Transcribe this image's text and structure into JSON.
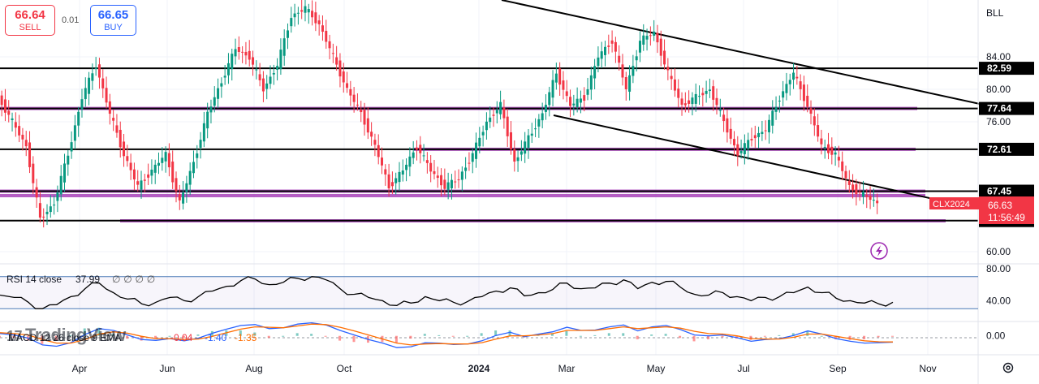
{
  "trade": {
    "sell_price": "66.64",
    "sell_label": "SELL",
    "spread": "0.01",
    "buy_price": "66.65",
    "buy_label": "BUY"
  },
  "symbol": "BLL",
  "watermark": "TradingView",
  "colors": {
    "up": "#089981",
    "down": "#f23645",
    "level": "#000000",
    "purple": "#9c27b0",
    "rsi": "#000000",
    "macd": "#2962ff",
    "signal": "#ff6d00"
  },
  "chart_data": [
    {
      "type": "candlestick",
      "title": "",
      "x_ticks": [
        "Apr",
        "Jun",
        "Aug",
        "Oct",
        "2024",
        "Mar",
        "May",
        "Jul",
        "Sep",
        "Nov"
      ],
      "y_ticks": [
        "84.00",
        "80.00",
        "76.00",
        "60.00"
      ],
      "ylim": [
        58.5,
        91
      ],
      "grid": true,
      "levels": [
        82.59,
        77.64,
        72.61,
        67.45,
        63.83
      ],
      "purple_zones": [
        77.64,
        72.61,
        67.45,
        66.9,
        63.8
      ],
      "current_price": "66.63",
      "symbol_label": "CLX2024",
      "countdown": "11:56:49",
      "series": [
        {
          "name": "",
          "values": [
            79,
            76,
            73,
            64,
            66,
            72,
            79,
            83,
            77,
            72,
            68,
            70,
            72,
            66,
            71,
            77,
            81,
            85,
            84,
            80,
            83,
            89,
            90,
            88,
            84,
            80,
            77,
            73,
            68,
            70,
            73,
            70,
            68,
            69,
            72,
            76,
            78,
            71,
            74,
            77,
            82,
            78,
            79,
            84,
            86,
            80,
            86,
            87,
            82,
            78,
            79,
            80,
            76,
            72,
            74,
            75,
            79,
            82,
            78,
            73,
            72,
            68,
            67,
            66
          ]
        }
      ]
    },
    {
      "type": "line",
      "title": "",
      "label": "RSI 14 close",
      "value": "37.99",
      "extra": "∅ ∅ ∅ ∅",
      "y_ticks": [
        "80.00",
        "40.00"
      ],
      "ylim": [
        15,
        85
      ],
      "bands": [
        70,
        30
      ],
      "series": [
        {
          "name": "",
          "values": [
            47,
            44,
            38,
            30,
            35,
            45,
            55,
            62,
            50,
            42,
            36,
            38,
            44,
            40,
            45,
            52,
            58,
            65,
            67,
            60,
            63,
            68,
            70,
            66,
            55,
            48,
            44,
            40,
            34,
            37,
            45,
            40,
            38,
            39,
            45,
            52,
            56,
            46,
            50,
            54,
            62,
            55,
            56,
            62,
            66,
            55,
            63,
            64,
            57,
            48,
            47,
            50,
            45,
            40,
            44,
            45,
            50,
            57,
            50,
            43,
            40,
            37,
            36,
            38
          ]
        }
      ]
    },
    {
      "type": "line",
      "title": "",
      "label": "MACD 12 26 close 9 EMA",
      "values_label": [
        "-0.04",
        "-1.40",
        "-1.35"
      ],
      "y_ticks": [
        "0.00"
      ],
      "ylim": [
        -4,
        3
      ],
      "series": [
        {
          "name": "",
          "values": [
            0.5,
            0.2,
            -0.5,
            -2.0,
            -2.3,
            -1.5,
            0.3,
            1.6,
            1.2,
            0.2,
            -0.8,
            -1.0,
            -0.6,
            -1.1,
            -0.5,
            0.6,
            1.5,
            2.3,
            2.5,
            1.6,
            1.8,
            2.6,
            2.9,
            2.4,
            1.2,
            0.2,
            -0.8,
            -1.6,
            -2.6,
            -2.4,
            -1.5,
            -1.6,
            -1.9,
            -1.8,
            -1.1,
            0.1,
            0.8,
            -0.2,
            0.4,
            0.9,
            1.9,
            1.2,
            1.3,
            2.0,
            2.4,
            1.1,
            2.0,
            2.3,
            1.4,
            0.2,
            0.0,
            0.2,
            -0.4,
            -1.2,
            -0.8,
            -0.6,
            0.1,
            1.1,
            0.4,
            -0.6,
            -1.2,
            -1.6,
            -1.5,
            -1.4
          ]
        },
        {
          "name": "",
          "values": [
            0.7,
            0.5,
            0.2,
            -0.8,
            -1.6,
            -1.6,
            -0.8,
            0.4,
            0.9,
            0.6,
            -0.1,
            -0.6,
            -0.6,
            -0.8,
            -0.7,
            -0.1,
            0.7,
            1.5,
            2.0,
            1.9,
            1.8,
            2.2,
            2.6,
            2.5,
            1.9,
            1.1,
            0.2,
            -0.7,
            -1.6,
            -2.0,
            -1.8,
            -1.7,
            -1.8,
            -1.8,
            -1.5,
            -0.7,
            0.0,
            0.0,
            0.2,
            0.5,
            1.2,
            1.2,
            1.2,
            1.6,
            2.0,
            1.6,
            1.8,
            2.0,
            1.7,
            1.0,
            0.5,
            0.4,
            0.0,
            -0.6,
            -0.7,
            -0.7,
            -0.3,
            0.4,
            0.4,
            -0.1,
            -0.6,
            -1.1,
            -1.3,
            -1.35
          ]
        }
      ]
    }
  ]
}
